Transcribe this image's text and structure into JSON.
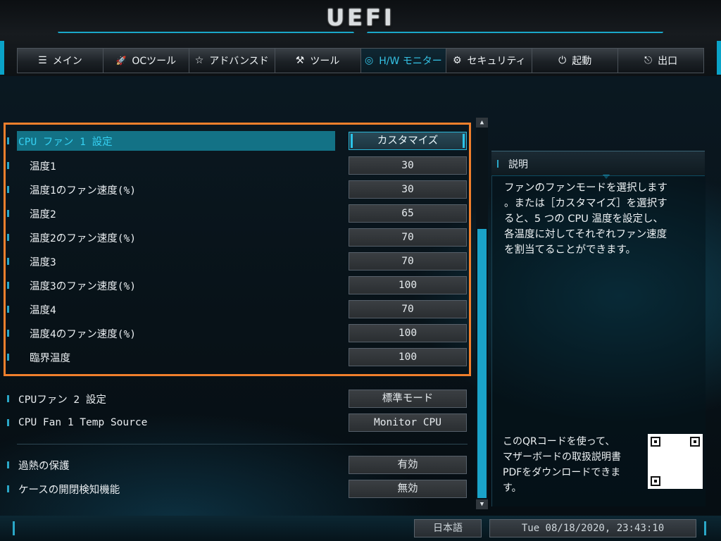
{
  "app": {
    "logo": "UEFI"
  },
  "tabs": [
    {
      "icon": "☰",
      "label": "メイン",
      "active": false
    },
    {
      "icon": "🚀",
      "label": "OCツール",
      "active": false
    },
    {
      "icon": "☆",
      "label": "アドバンスド",
      "active": false
    },
    {
      "icon": "⚒",
      "label": "ツール",
      "active": false
    },
    {
      "icon": "◎",
      "label": "H/W モニター",
      "active": true
    },
    {
      "icon": "⚙",
      "label": "セキュリティ",
      "active": false
    },
    {
      "icon": "⏻",
      "label": "起動",
      "active": false
    },
    {
      "icon": "⎋",
      "label": "出口",
      "active": false
    }
  ],
  "settings": {
    "fan1_header": {
      "label": "CPU ファン 1 設定",
      "value": "カスタマイズ"
    },
    "rows": [
      {
        "label": "温度1",
        "value": "30"
      },
      {
        "label": "温度1のファン速度(%)",
        "value": "30"
      },
      {
        "label": "温度2",
        "value": "65"
      },
      {
        "label": "温度2のファン速度(%)",
        "value": "70"
      },
      {
        "label": "温度3",
        "value": "70"
      },
      {
        "label": "温度3のファン速度(%)",
        "value": "100"
      },
      {
        "label": "温度4",
        "value": "70"
      },
      {
        "label": "温度4のファン速度(%)",
        "value": "100"
      },
      {
        "label": "臨界温度",
        "value": "100"
      }
    ],
    "fan2": {
      "label": "CPUファン 2 設定",
      "value": "標準モード"
    },
    "temp_source": {
      "label": "CPU Fan 1 Temp Source",
      "value": "Monitor CPU"
    },
    "overheat": {
      "label": "過熱の保護",
      "value": "有効"
    },
    "chassis": {
      "label": "ケースの開閉検知機能",
      "value": "無効"
    }
  },
  "description": {
    "title": "説明",
    "text": "ファンのファンモードを選択します\n。または［カスタマイズ］を選択す\nると、5 つの CPU 温度を設定し、\n各温度に対してそれぞれファン速度\nを割当てることができます。",
    "qr_text": "このQRコードを使って、\nマザーボードの取扱説明書\nPDFをダウンロードできま\nす。"
  },
  "footer": {
    "language": "日本語",
    "datetime": "Tue 08/18/2020, 23:43:10"
  },
  "icons": {
    "scroll_up": "scroll-up-icon",
    "scroll_down": "scroll-down-icon",
    "qr": "qr-code-icon"
  },
  "colors": {
    "accent": "#1aa3c9",
    "highlight_border": "#f07f2c",
    "selected_bar": "#137286"
  }
}
